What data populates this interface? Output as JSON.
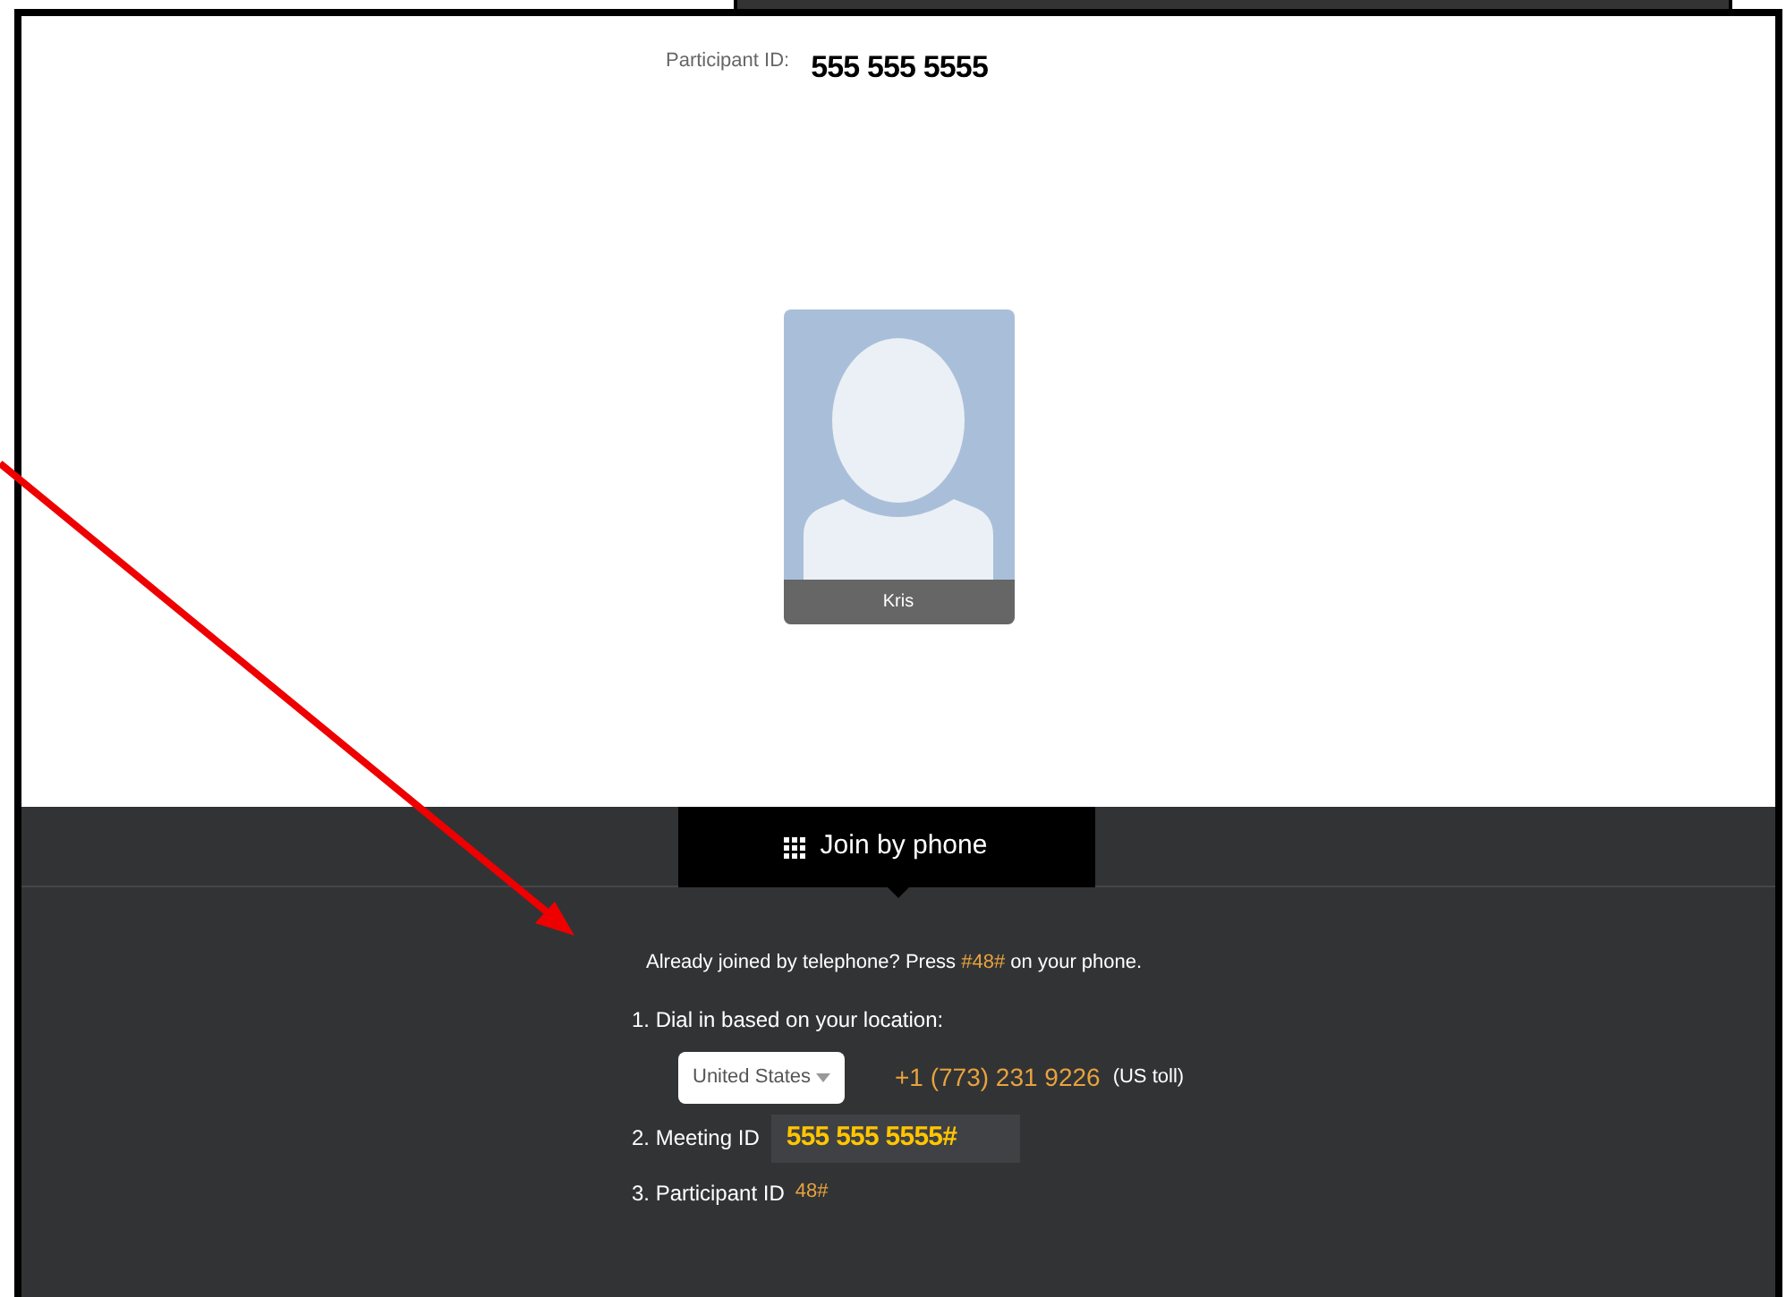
{
  "header": {
    "label": "Participant ID:",
    "value": "555 555 5555"
  },
  "participant": {
    "name": "Kris"
  },
  "join_tab": {
    "label": "Join by phone",
    "selected": true
  },
  "notice": {
    "before": "Already joined by telephone? Press",
    "code": "#48#",
    "after": "on your phone."
  },
  "dial": {
    "label": "1. Dial in based on your location:",
    "country": "United States",
    "phone": "+1 (773) 231 9226",
    "note": "(US toll)"
  },
  "meeting": {
    "label": "2. Meeting ID",
    "value": "555 555 5555#"
  },
  "participant_step": {
    "label": "3. Participant ID",
    "value": "48#"
  }
}
